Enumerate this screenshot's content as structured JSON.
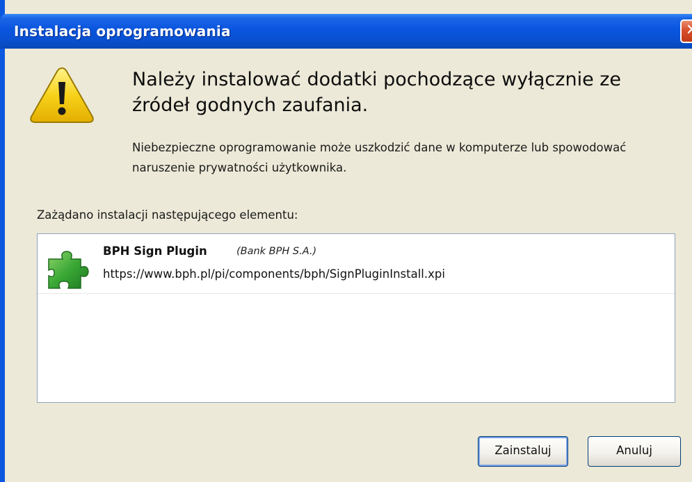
{
  "window": {
    "title": "Instalacja oprogramowania",
    "close_label": "✕"
  },
  "warning": {
    "icon": "warning-triangle-icon",
    "headline": "Należy instalować dodatki pochodzące wyłącznie ze źródeł godnych zaufania.",
    "description": "Niebezpieczne oprogramowanie może uszkodzić dane w komputerze lub spowodować naruszenie prywatności użytkownika."
  },
  "request": {
    "caption": "Zażądano instalacji następującego elementu:",
    "items": [
      {
        "icon": "puzzle-piece-icon",
        "name": "BPH Sign Plugin",
        "vendor": "(Bank BPH S.A.)",
        "url": "https://www.bph.pl/pi/components/bph/SignPluginInstall.xpi"
      }
    ]
  },
  "buttons": {
    "install": "Zainstaluj",
    "cancel": "Anuluj"
  },
  "colors": {
    "titlebar": "#0a55de",
    "dialog_bg": "#ece9d8",
    "warning_yellow": "#f5c800",
    "puzzle_green": "#3aa835"
  }
}
